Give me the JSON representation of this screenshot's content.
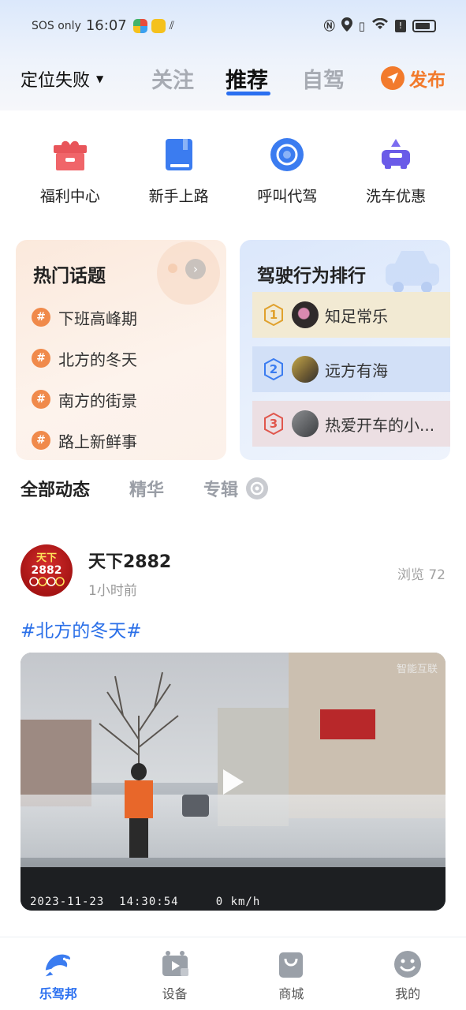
{
  "status_bar": {
    "carrier": "SOS only",
    "time": "16:07"
  },
  "nav": {
    "location": "定位失败",
    "tabs": [
      "关注",
      "推荐",
      "自驾"
    ],
    "active_tab": "推荐",
    "publish_label": "发布"
  },
  "quick_menu": [
    {
      "label": "福利中心",
      "icon": "gift-icon"
    },
    {
      "label": "新手上路",
      "icon": "book-icon"
    },
    {
      "label": "呼叫代驾",
      "icon": "driver-call-icon"
    },
    {
      "label": "洗车优惠",
      "icon": "car-wash-icon"
    }
  ],
  "hot_topics": {
    "title": "热门话题",
    "items": [
      "下班高峰期",
      "北方的冬天",
      "南方的街景",
      "路上新鲜事"
    ]
  },
  "driving_rank": {
    "title": "驾驶行为排行",
    "items": [
      {
        "rank": "1",
        "name": "知足常乐"
      },
      {
        "rank": "2",
        "name": "远方有海"
      },
      {
        "rank": "3",
        "name": "热爱开车的小..."
      }
    ]
  },
  "feed_tabs": [
    "全部动态",
    "精华",
    "专辑"
  ],
  "post": {
    "avatar_text_top": "天下",
    "avatar_text_bottom": "2882",
    "author": "天下2882",
    "time": "1小时前",
    "views": "浏览 72",
    "tag": "#北方的冬天#",
    "video_stamp": "2023-11-23  14:30:54     0 km/h",
    "video_brand": "智能互联"
  },
  "bottom_nav": [
    {
      "label": "乐驾邦",
      "active": true
    },
    {
      "label": "设备",
      "active": false
    },
    {
      "label": "商城",
      "active": false
    },
    {
      "label": "我的",
      "active": false
    }
  ],
  "colors": {
    "accent_blue": "#2a6ff0",
    "publish_orange": "#f27a2c",
    "topic_orange": "#f08a4b"
  }
}
